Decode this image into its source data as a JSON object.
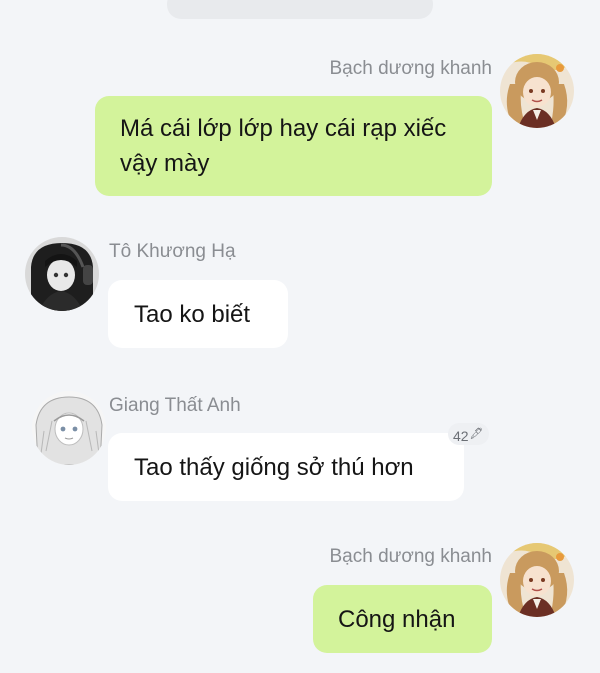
{
  "messages": [
    {
      "sender": "Bạch dương khanh",
      "text": "Má cái lớp lớp hay cái rạp xiếc vậy mày",
      "own": true
    },
    {
      "sender": "Tô Khương Hạ",
      "text": "Tao ko biết",
      "own": false
    },
    {
      "sender": "Giang Thất Anh",
      "text": "Tao thấy giống sở thú hơn",
      "own": false,
      "badge": "42"
    },
    {
      "sender": "Bạch dương khanh",
      "text": "Công nhận",
      "own": true
    }
  ],
  "colors": {
    "background": "#f3f5f8",
    "own_bubble": "#d3f39b",
    "other_bubble": "#ffffff",
    "sender_name": "#8a8d92"
  }
}
